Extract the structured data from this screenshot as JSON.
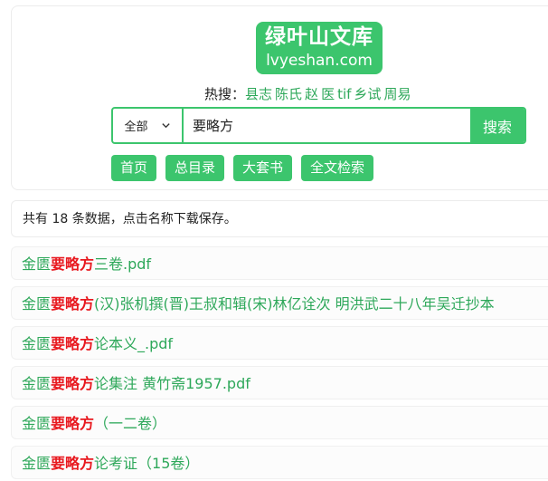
{
  "logo": {
    "title_cn": "绿叶山文库",
    "title_en": "lvyeshan.com"
  },
  "hot_search": {
    "label": "热搜：",
    "terms": [
      "县志",
      "陈氏",
      "赵",
      "医",
      "tif",
      "乡试",
      "周易"
    ]
  },
  "search": {
    "scope": "全部",
    "query": "要略方",
    "button_label": "搜索"
  },
  "nav": [
    "首页",
    "总目录",
    "大套书",
    "全文检索"
  ],
  "result_count_text": "共有 18 条数据，点击名称下载保存。",
  "results": [
    {
      "prefix": "金匮",
      "highlight": "要略方",
      "suffix": "三卷.pdf"
    },
    {
      "prefix": "金匮",
      "highlight": "要略方",
      "suffix": "(汉)张机撰(晋)王叔和辑(宋)林亿诠次 明洪武二十八年吴迁抄本"
    },
    {
      "prefix": "金匮",
      "highlight": "要略方",
      "suffix": "论本义_.pdf"
    },
    {
      "prefix": "金匮",
      "highlight": "要略方",
      "suffix": "论集注 黄竹斋1957.pdf"
    },
    {
      "prefix": "金匮",
      "highlight": "要略方",
      "suffix": "（一二卷）"
    },
    {
      "prefix": "金匮",
      "highlight": "要略方",
      "suffix": "论考证（15卷）"
    }
  ],
  "colors": {
    "brand_green": "#3cc56d",
    "link_green": "#2ea85a",
    "highlight_red": "#e8191f"
  }
}
